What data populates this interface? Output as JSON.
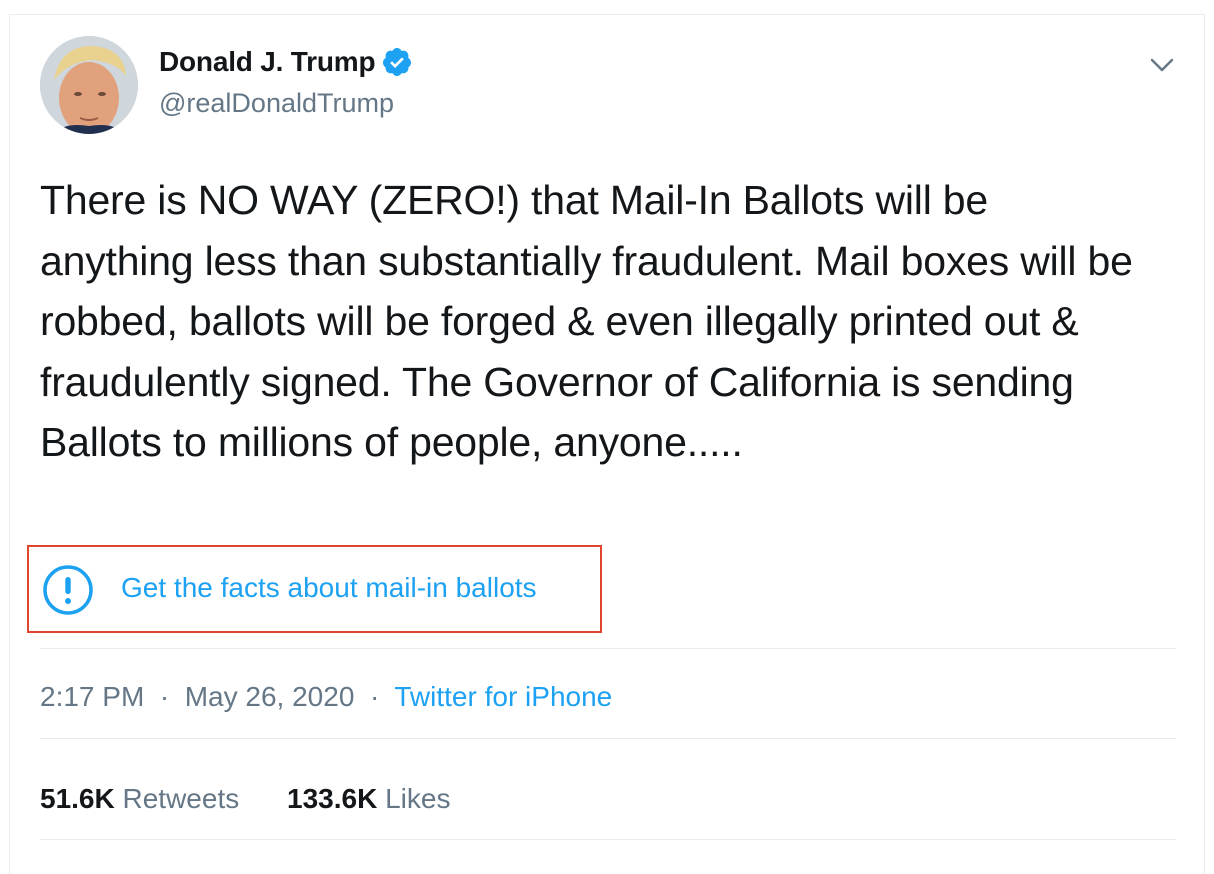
{
  "tweet": {
    "author": {
      "name": "Donald J. Trump",
      "handle": "@realDonaldTrump",
      "verified": true
    },
    "text": "There is NO WAY (ZERO!) that Mail-In Ballots will be anything less than substantially fraudulent. Mail boxes will be robbed, ballots will be forged & even illegally printed out & fraudulently signed. The Governor of California is sending Ballots to millions of people, anyone.....",
    "fact_check": {
      "label": "Get the facts about mail-in ballots",
      "icon": "exclamation-circle-icon",
      "highlight_color": "#e0462d"
    },
    "time": "2:17 PM",
    "separator": "·",
    "date": "May 26, 2020",
    "source": "Twitter for iPhone",
    "stats": {
      "retweets_count": "51.6K",
      "retweets_label": "Retweets",
      "likes_count": "133.6K",
      "likes_label": "Likes"
    }
  },
  "colors": {
    "accent": "#1da1f2",
    "text": "#14171a",
    "secondary": "#657786",
    "border": "#e6ecf0"
  }
}
